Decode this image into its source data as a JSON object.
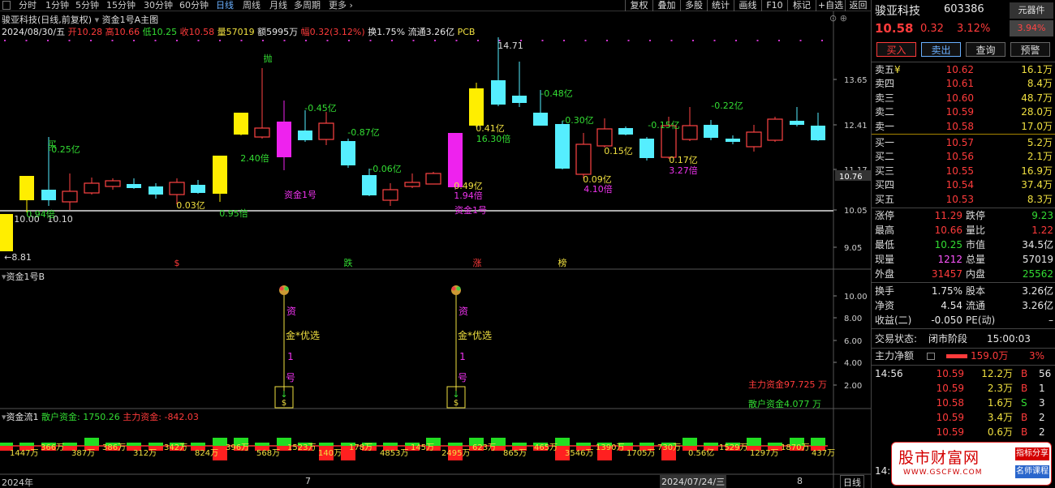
{
  "toolbar": {
    "periods": [
      "分时",
      "1分钟",
      "5分钟",
      "15分钟",
      "30分钟",
      "60分钟",
      "日线",
      "周线",
      "月线",
      "多周期",
      "更多"
    ],
    "active_period": "日线",
    "buttons": [
      "复权",
      "叠加",
      "多股",
      "统计",
      "画线",
      "F10",
      "标记",
      "+自选",
      "返回"
    ]
  },
  "chart": {
    "header": {
      "title": "骏亚科技(日线,前复权)",
      "indicator": "资金1号A主图",
      "date": "2024/08/30/五",
      "open_label": "开",
      "open": "10.28",
      "high_label": "高",
      "high": "10.66",
      "low_label": "低",
      "low": "10.25",
      "close_label": "收",
      "close": "10.58",
      "volume_label": "量",
      "volume": "57019",
      "amount_label": "额",
      "amount": "5995万",
      "change_label": "幅",
      "change": "0.32(3.12%)",
      "turnover_label": "换",
      "turnover": "1.75%",
      "float_label": "流通",
      "float": "3.26亿",
      "pcb": "PCB"
    },
    "y_ticks": [
      "13.65",
      "12.41",
      "11.17",
      "10.05",
      "9.05"
    ],
    "current_price": "10.76",
    "annotations": {
      "high": "14.71",
      "low": "8.81",
      "low_arrow": "←",
      "throw": "抛",
      "buy": "买",
      "fund_label_1": "资金1号",
      "fund_label_2": "资金1号",
      "bear": "跌",
      "bull": "涨",
      "s_mark": "$",
      "top_mark": "榜",
      "amounts": [
        "-0.25亿",
        "2.40倍",
        "-0.45亿",
        "-0.87亿",
        "-0.06亿",
        "0.03亿",
        "0.95倍",
        "0.49亿",
        "1.94倍",
        "0.41亿",
        "16.30倍",
        "-0.48亿",
        "-0.30亿",
        "0.09亿",
        "4.10倍",
        "0.15亿",
        "-0.15亿",
        "0.17亿",
        "3.27倍",
        "-0.22亿",
        "10.00",
        "10.10",
        "0.94倍"
      ]
    },
    "pane2": {
      "title": "资金1号B",
      "y_ticks": [
        "10.00",
        "8.00",
        "6.00",
        "4.00",
        "2.00"
      ],
      "signal_text": [
        "资",
        "金*优选",
        "1",
        "号"
      ],
      "main_force": "主力资金97.725",
      "main_unit": "万",
      "retail": "散户资金4.077",
      "retail_unit": "万"
    },
    "pane3": {
      "title": "资金流1",
      "retail_label": "散户资金:",
      "retail_value": "1750.26",
      "main_label": "主力资金:",
      "main_value": "-842.03",
      "bar_labels": [
        "1447万",
        "366万",
        "387万",
        "386万",
        "312万",
        "342万",
        "824万",
        "396万",
        "568万",
        "1523万",
        "140万",
        "178万",
        "4853万",
        "145万",
        "2495万",
        "623万",
        "865万",
        "465万",
        "3546万",
        "1390万",
        "1705万",
        "730万",
        "0.56亿",
        "1529万",
        "1297万",
        "1870万",
        "437万"
      ]
    },
    "x_axis": [
      "2024年",
      "7",
      "2024/07/24/三",
      "8"
    ],
    "period_label": "日线"
  },
  "quote": {
    "name": "骏亚科技",
    "code": "603386",
    "sector": "元器件",
    "sector_change": "3.94%",
    "price": "10.58",
    "change": "0.32",
    "change_pct": "3.12%",
    "actions": [
      "买入",
      "卖出",
      "查询",
      "预警"
    ],
    "asks": [
      {
        "label": "卖五",
        "mark": "¥",
        "price": "10.62",
        "vol": "16.1万"
      },
      {
        "label": "卖四",
        "mark": "",
        "price": "10.61",
        "vol": "8.4万"
      },
      {
        "label": "卖三",
        "mark": "",
        "price": "10.60",
        "vol": "48.7万"
      },
      {
        "label": "卖二",
        "mark": "",
        "price": "10.59",
        "vol": "28.0万"
      },
      {
        "label": "卖一",
        "mark": "",
        "price": "10.58",
        "vol": "17.0万"
      }
    ],
    "bids": [
      {
        "label": "买一",
        "price": "10.57",
        "vol": "5.2万"
      },
      {
        "label": "买二",
        "price": "10.56",
        "vol": "2.1万"
      },
      {
        "label": "买三",
        "price": "10.55",
        "vol": "16.9万"
      },
      {
        "label": "买四",
        "price": "10.54",
        "vol": "37.4万"
      },
      {
        "label": "买五",
        "price": "10.53",
        "vol": "8.3万"
      }
    ],
    "stats": [
      {
        "l1": "涨停",
        "v1": "11.29",
        "c1": "red",
        "l2": "跌停",
        "v2": "9.23",
        "c2": "green"
      },
      {
        "l1": "最高",
        "v1": "10.66",
        "c1": "red",
        "l2": "量比",
        "v2": "1.22",
        "c2": "red"
      },
      {
        "l1": "最低",
        "v1": "10.25",
        "c1": "green",
        "l2": "市值",
        "v2": "34.5亿",
        "c2": "white"
      },
      {
        "l1": "现量",
        "v1": "1212",
        "c1": "magenta",
        "l2": "总量",
        "v2": "57019",
        "c2": "white"
      },
      {
        "l1": "外盘",
        "v1": "31457",
        "c1": "red",
        "l2": "内盘",
        "v2": "25562",
        "c2": "green"
      }
    ],
    "stats2": [
      {
        "l1": "换手",
        "v1": "1.75%",
        "l2": "股本",
        "v2": "3.26亿"
      },
      {
        "l1": "净资",
        "v1": "4.54",
        "l2": "流通",
        "v2": "3.26亿"
      },
      {
        "l1": "收益(二)",
        "v1": "-0.050",
        "l2": "PE(动)",
        "v2": "–"
      }
    ],
    "trade_status_label": "交易状态:",
    "trade_status": "闭市阶段",
    "trade_time": "15:00:03",
    "net_label": "主力净额",
    "net_value": "159.0万",
    "net_pct": "3%",
    "ticks": [
      {
        "time": "14:56",
        "price": "10.59",
        "vol": "12.2万",
        "side": "B",
        "n": "56"
      },
      {
        "time": "",
        "price": "10.59",
        "vol": "2.3万",
        "side": "B",
        "n": "1"
      },
      {
        "time": "",
        "price": "10.58",
        "vol": "1.6万",
        "side": "S",
        "n": "3"
      },
      {
        "time": "",
        "price": "10.59",
        "vol": "3.4万",
        "side": "B",
        "n": "2"
      },
      {
        "time": "",
        "price": "10.59",
        "vol": "0.6万",
        "side": "B",
        "n": "2"
      }
    ],
    "bottom_time": "14:5"
  },
  "logo": {
    "text": "股市财富网",
    "url": "WWW.GSCFW.COM",
    "tag1": "指标分享",
    "tag2": "名师课程"
  },
  "colors": {
    "up_yellow": "#ffee00",
    "up_magenta": "#ee22ee",
    "down_cyan": "#55eeff",
    "up_outline": "#ff4444",
    "bar_red": "#ff2020",
    "bar_green": "#22dd22"
  }
}
